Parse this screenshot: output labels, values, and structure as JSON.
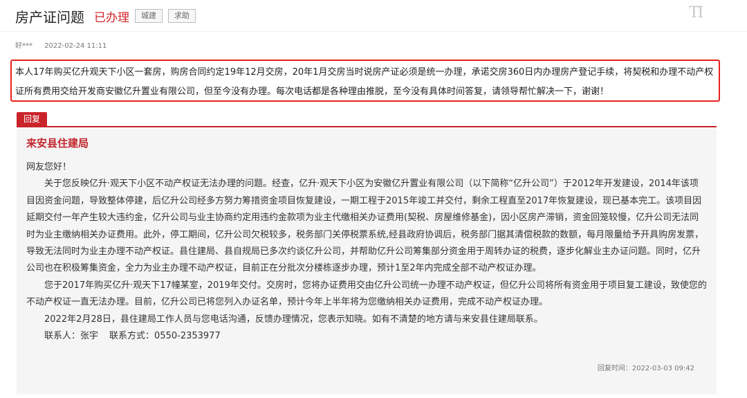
{
  "header": {
    "title": "房产证问题",
    "status": "已办理",
    "tags": [
      "城建",
      "求助"
    ],
    "font_toggle": "TI"
  },
  "meta": {
    "author": "好***",
    "posted_time": "2022-02-24 11:11"
  },
  "question": {
    "text": "本人17年购买亿升观天下小区一套房，购房合同约定19年12月交房，20年1月交房当时说房产证必须是统一办理，承诺交房360日内办理房产登记手续，将契税和办理不动产权证所有费用交给开发商安徽亿升置业有限公司，但至今没有办理。每次电话都是各种理由推脱，至今没有具体时间答复，请领导帮忙解决一下，谢谢！"
  },
  "reply": {
    "tag": "回复",
    "org": "来安县住建局",
    "greeting": "网友您好！",
    "paragraphs": [
      "关于您反映亿升·观天下小区不动产权证无法办理的问题。经查，亿升·观天下小区为安徽亿升置业有限公司（以下简称“亿升公司”）于2012年开发建设，2014年该项目因资金问题，导致整体停建，后亿升公司经多方努力筹措资金项目恢复建设，一期工程于2015年竣工并交付，剩余工程直至2017年恢复建设，现已基本完工。该项目因延期交付一年产生较大违约金，亿升公司与业主协商约定用违约金款项为业主代缴相关办证费用(契税、房屋维修基金)，因小区房产滞销，资金回笼较慢，亿升公司无法同时为业主缴纳相关办证费用。此外，停工期间，亿升公司欠税较多，税务部门关停税票系统,经县政府协调后，税务部门据其清偿税款的数额，每月限量给予开具购房发票，导致无法同时为业主办理不动产权证。县住建局、县自规局已多次约谈亿升公司，并帮助亿升公司筹集部分资金用于周转办证的税费，逐步化解业主办证问题。同时，亿升公司也在积极筹集资金，全力为业主办理不动产权证，目前正在分批次分楼栋逐步办理，预计1至2年内完成全部不动产权证办理。",
      "您于2017年购买亿升·观天下17幢某室，2019年交付。交房时，您将办证费用交由亿升公司统一办理不动产权证，但亿升公司将所有资金用于项目复工建设，致使您的不动产权证一直无法办理。目前，亿升公司已将您列入办证名单，预计今年上半年将为您缴纳相关办证费用，完成不动产权证办理。",
      "2022年2月28日，县住建局工作人员与您电话沟通，反馈办理情况，您表示知晓。如有不清楚的地方请与来安县住建局联系。"
    ],
    "contact_person_label": "联系人：",
    "contact_person": "张宇",
    "contact_phone_label": "联系方式：",
    "contact_phone": "0550-2353977",
    "reply_time_label": "回复时间：",
    "reply_time": "2022-03-03 09:42"
  },
  "colors": {
    "accent_red": "#c9242a",
    "status_red": "#d1252b",
    "highlight_border": "#e8201f",
    "reply_bg": "#f5f5f5"
  }
}
